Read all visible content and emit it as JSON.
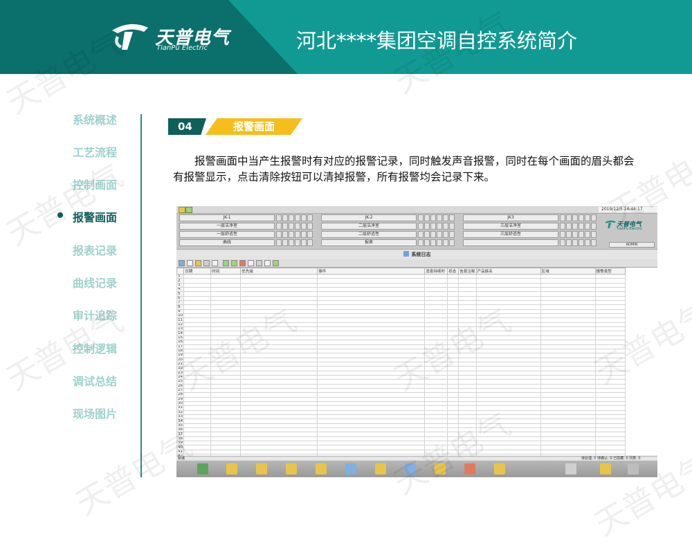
{
  "header": {
    "logo_cn": "天普电气",
    "logo_en": "TianPu Electric",
    "title": "河北****集团空调自控系统简介"
  },
  "sidebar": {
    "items": [
      {
        "label": "系统概述",
        "active": false
      },
      {
        "label": "工艺流程",
        "active": false
      },
      {
        "label": "控制画面",
        "active": false
      },
      {
        "label": "报警画面",
        "active": true
      },
      {
        "label": "报表记录",
        "active": false
      },
      {
        "label": "曲线记录",
        "active": false
      },
      {
        "label": "审计追踪",
        "active": false
      },
      {
        "label": "控制逻辑",
        "active": false
      },
      {
        "label": "调试总结",
        "active": false
      },
      {
        "label": "现场图片",
        "active": false
      }
    ]
  },
  "section": {
    "number": "04",
    "title": "报警画面",
    "description": "报警画面中当产生报警时有对应的报警记录，同时触发声音报警，同时在每个画面的眉头都会有报警显示，点击清除按钮可以清掉报警，所有报警均会记录下来。"
  },
  "screenshot": {
    "datetime": "2019/12/5 14:44:17",
    "logo_cn": "天普电气",
    "logo_en": "TianPu Electric",
    "status": "ADMIN",
    "nav_buttons": [
      [
        "JK-1",
        "JK-2",
        "JK3"
      ],
      [
        "一层洁净室",
        "二层洁净室",
        "三层洁净室"
      ],
      [
        "一层舒适性",
        "二层舒适性",
        "三层舒适性"
      ],
      [
        "曲线",
        "报表",
        ""
      ]
    ],
    "log_title": "系统日志",
    "columns": [
      "日期",
      "时间",
      "优先级",
      "事件",
      "消息持续时",
      "状态",
      "信息注释",
      "产品族名",
      "区域",
      "报警类型"
    ],
    "row_count": 43,
    "footer_left": "就绪",
    "footer_right": "待处理: 0  待确认: 0  已隐藏: 0  列表: 0"
  },
  "colors": {
    "teal": "#119a93",
    "dark_teal": "#0f5f5b",
    "accent_yellow": "#f6be1a",
    "nav_inactive": "#9fd1cd"
  },
  "watermark": "天普电气"
}
